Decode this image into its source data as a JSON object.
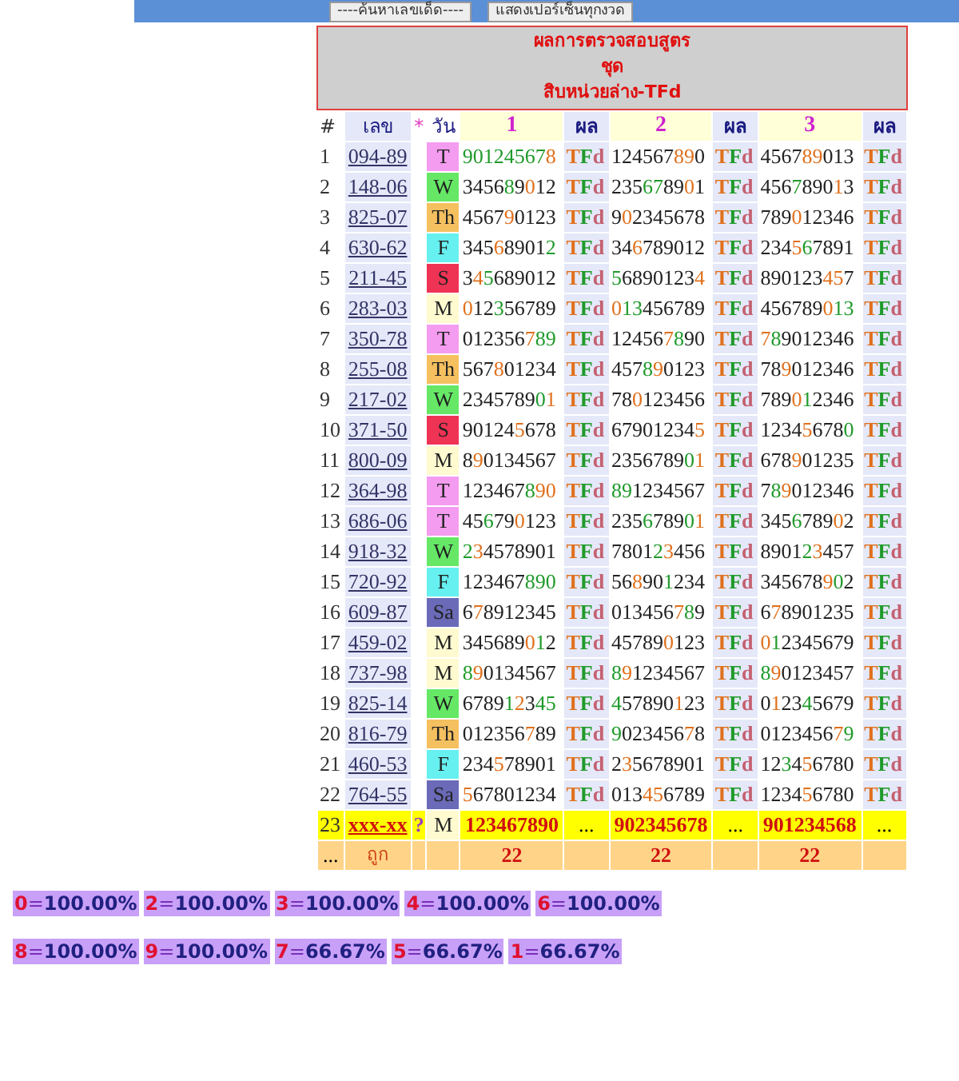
{
  "top_bar": {
    "buttons": [
      "----ค้นหาเลขเด็ด----",
      "แสดงเปอร์เซ็นทุกงวด"
    ]
  },
  "title": [
    "ผลการตรวจสอบสูตร",
    "ชุด",
    "สิบหน่วยล่าง-TFd"
  ],
  "columns": [
    "#",
    "เลข",
    "*",
    "วัน",
    "1",
    "ผล",
    "2",
    "ผล",
    "3",
    "ผล"
  ],
  "rows": [
    {
      "kind": "check",
      "no": "1",
      "number": "094-89",
      "day": "T",
      "color": "#f49cf0",
      "sets": [
        {
          "segments": [
            {
              "text": "90124567",
              "color": "#1f9a2a"
            },
            {
              "text": "8",
              "color": "#e0701c"
            }
          ],
          "result": "TFd"
        },
        {
          "segments": [
            {
              "text": "124567",
              "color": "#222222"
            },
            {
              "text": "89",
              "color": "#e0701c"
            },
            {
              "text": "0",
              "color": "#222222"
            }
          ],
          "result": "TFd"
        },
        {
          "segments": [
            {
              "text": "4567",
              "color": "#222222"
            },
            {
              "text": "89",
              "color": "#e0701c"
            },
            {
              "text": "013",
              "color": "#222222"
            }
          ],
          "result": "TFd"
        }
      ]
    },
    {
      "kind": "check",
      "no": "2",
      "number": "148-06",
      "day": "W",
      "color": "#66e866",
      "sets": [
        {
          "segments": [
            {
              "text": "3456",
              "color": "#222222"
            },
            {
              "text": "8",
              "color": "#1f9a2a"
            },
            {
              "text": "9",
              "color": "#222222"
            },
            {
              "text": "0",
              "color": "#e0701c"
            },
            {
              "text": "12",
              "color": "#222222"
            }
          ],
          "result": "TFd"
        },
        {
          "segments": [
            {
              "text": "235",
              "color": "#222222"
            },
            {
              "text": "67",
              "color": "#1f9a2a"
            },
            {
              "text": "89",
              "color": "#222222"
            },
            {
              "text": "0",
              "color": "#e0701c"
            },
            {
              "text": "1",
              "color": "#222222"
            }
          ],
          "result": "TFd"
        },
        {
          "segments": [
            {
              "text": "456",
              "color": "#222222"
            },
            {
              "text": "7",
              "color": "#1f9a2a"
            },
            {
              "text": "890",
              "color": "#222222"
            },
            {
              "text": "1",
              "color": "#e0701c"
            },
            {
              "text": "3",
              "color": "#222222"
            }
          ],
          "result": "TFd"
        }
      ]
    },
    {
      "kind": "check",
      "no": "3",
      "number": "825-07",
      "day": "Th",
      "color": "#f5c060",
      "sets": [
        {
          "segments": [
            {
              "text": "4567",
              "color": "#222222"
            },
            {
              "text": "9",
              "color": "#e0701c"
            },
            {
              "text": "0123",
              "color": "#222222"
            }
          ],
          "result": "TFd"
        },
        {
          "segments": [
            {
              "text": "9",
              "color": "#222222"
            },
            {
              "text": "0",
              "color": "#e0701c"
            },
            {
              "text": "2345678",
              "color": "#222222"
            }
          ],
          "result": "TFd"
        },
        {
          "segments": [
            {
              "text": "789",
              "color": "#222222"
            },
            {
              "text": "0",
              "color": "#e0701c"
            },
            {
              "text": "12346",
              "color": "#222222"
            }
          ],
          "result": "TFd"
        }
      ]
    },
    {
      "kind": "check",
      "no": "4",
      "number": "630-62",
      "day": "F",
      "color": "#66f0f0",
      "sets": [
        {
          "segments": [
            {
              "text": "345",
              "color": "#222222"
            },
            {
              "text": "6",
              "color": "#e0701c"
            },
            {
              "text": "8901",
              "color": "#222222"
            },
            {
              "text": "2",
              "color": "#1f9a2a"
            }
          ],
          "result": "TFd"
        },
        {
          "segments": [
            {
              "text": "34",
              "color": "#222222"
            },
            {
              "text": "6",
              "color": "#e0701c"
            },
            {
              "text": "789012",
              "color": "#222222"
            }
          ],
          "result": "TFd"
        },
        {
          "segments": [
            {
              "text": "234",
              "color": "#222222"
            },
            {
              "text": "5",
              "color": "#e0701c"
            },
            {
              "text": "6",
              "color": "#1f9a2a"
            },
            {
              "text": "7891",
              "color": "#222222"
            }
          ],
          "result": "TFd"
        }
      ]
    },
    {
      "kind": "check",
      "no": "5",
      "number": "211-45",
      "day": "S",
      "color": "#ee3355",
      "sets": [
        {
          "segments": [
            {
              "text": "3",
              "color": "#222222"
            },
            {
              "text": "4",
              "color": "#e0701c"
            },
            {
              "text": "5",
              "color": "#1f9a2a"
            },
            {
              "text": "689012",
              "color": "#222222"
            }
          ],
          "result": "TFd"
        },
        {
          "segments": [
            {
              "text": "5",
              "color": "#1f9a2a"
            },
            {
              "text": "6890123",
              "color": "#222222"
            },
            {
              "text": "4",
              "color": "#e0701c"
            }
          ],
          "result": "TFd"
        },
        {
          "segments": [
            {
              "text": "890123",
              "color": "#222222"
            },
            {
              "text": "45",
              "color": "#e0701c"
            },
            {
              "text": "7",
              "color": "#222222"
            }
          ],
          "result": "TFd"
        }
      ]
    },
    {
      "kind": "check",
      "no": "6",
      "number": "283-03",
      "day": "M",
      "color": "#fffad0",
      "sets": [
        {
          "segments": [
            {
              "text": "0",
              "color": "#e0701c"
            },
            {
              "text": "12",
              "color": "#222222"
            },
            {
              "text": "3",
              "color": "#1f9a2a"
            },
            {
              "text": "56789",
              "color": "#222222"
            }
          ],
          "result": "TFd"
        },
        {
          "segments": [
            {
              "text": "0",
              "color": "#e0701c"
            },
            {
              "text": "13",
              "color": "#1f9a2a"
            },
            {
              "text": "456789",
              "color": "#222222"
            }
          ],
          "result": "TFd"
        },
        {
          "segments": [
            {
              "text": "456789",
              "color": "#222222"
            },
            {
              "text": "0",
              "color": "#e0701c"
            },
            {
              "text": "13",
              "color": "#1f9a2a"
            }
          ],
          "result": "TFd"
        }
      ]
    },
    {
      "kind": "check",
      "no": "7",
      "number": "350-78",
      "day": "T",
      "color": "#f49cf0",
      "sets": [
        {
          "segments": [
            {
              "text": "012356",
              "color": "#222222"
            },
            {
              "text": "7",
              "color": "#e0701c"
            },
            {
              "text": "89",
              "color": "#1f9a2a"
            }
          ],
          "result": "TFd"
        },
        {
          "segments": [
            {
              "text": "12456",
              "color": "#222222"
            },
            {
              "text": "7",
              "color": "#e0701c"
            },
            {
              "text": "8",
              "color": "#1f9a2a"
            },
            {
              "text": "90",
              "color": "#222222"
            }
          ],
          "result": "TFd"
        },
        {
          "segments": [
            {
              "text": "7",
              "color": "#e0701c"
            },
            {
              "text": "8",
              "color": "#1f9a2a"
            },
            {
              "text": "9012346",
              "color": "#222222"
            }
          ],
          "result": "TFd"
        }
      ]
    },
    {
      "kind": "check",
      "no": "8",
      "number": "255-08",
      "day": "Th",
      "color": "#f5c060",
      "sets": [
        {
          "segments": [
            {
              "text": "567",
              "color": "#222222"
            },
            {
              "text": "8",
              "color": "#e0701c"
            },
            {
              "text": "01234",
              "color": "#222222"
            }
          ],
          "result": "TFd"
        },
        {
          "segments": [
            {
              "text": "457",
              "color": "#222222"
            },
            {
              "text": "8",
              "color": "#1f9a2a"
            },
            {
              "text": "9",
              "color": "#e0701c"
            },
            {
              "text": "0123",
              "color": "#222222"
            }
          ],
          "result": "TFd"
        },
        {
          "segments": [
            {
              "text": "78",
              "color": "#222222"
            },
            {
              "text": "9",
              "color": "#e0701c"
            },
            {
              "text": "012346",
              "color": "#222222"
            }
          ],
          "result": "TFd"
        }
      ]
    },
    {
      "kind": "check",
      "no": "9",
      "number": "217-02",
      "day": "W",
      "color": "#66e866",
      "sets": [
        {
          "segments": [
            {
              "text": "2345789",
              "color": "#222222"
            },
            {
              "text": "0",
              "color": "#1f9a2a"
            },
            {
              "text": "1",
              "color": "#e0701c"
            }
          ],
          "result": "TFd"
        },
        {
          "segments": [
            {
              "text": "78",
              "color": "#222222"
            },
            {
              "text": "0",
              "color": "#e0701c"
            },
            {
              "text": "123456",
              "color": "#222222"
            }
          ],
          "result": "TFd"
        },
        {
          "segments": [
            {
              "text": "789",
              "color": "#222222"
            },
            {
              "text": "0",
              "color": "#e0701c"
            },
            {
              "text": "1",
              "color": "#1f9a2a"
            },
            {
              "text": "2346",
              "color": "#222222"
            }
          ],
          "result": "TFd"
        }
      ]
    },
    {
      "kind": "check",
      "no": "10",
      "number": "371-50",
      "day": "S",
      "color": "#ee3355",
      "sets": [
        {
          "segments": [
            {
              "text": "90124",
              "color": "#222222"
            },
            {
              "text": "5",
              "color": "#e0701c"
            },
            {
              "text": "678",
              "color": "#222222"
            }
          ],
          "result": "TFd"
        },
        {
          "segments": [
            {
              "text": "67901234",
              "color": "#222222"
            },
            {
              "text": "5",
              "color": "#e0701c"
            }
          ],
          "result": "TFd"
        },
        {
          "segments": [
            {
              "text": "1234",
              "color": "#222222"
            },
            {
              "text": "5",
              "color": "#e0701c"
            },
            {
              "text": "678",
              "color": "#222222"
            },
            {
              "text": "0",
              "color": "#1f9a2a"
            }
          ],
          "result": "TFd"
        }
      ]
    },
    {
      "kind": "check",
      "no": "11",
      "number": "800-09",
      "day": "M",
      "color": "#fffad0",
      "sets": [
        {
          "segments": [
            {
              "text": "8",
              "color": "#222222"
            },
            {
              "text": "9",
              "color": "#e0701c"
            },
            {
              "text": "0134567",
              "color": "#222222"
            }
          ],
          "result": "TFd"
        },
        {
          "segments": [
            {
              "text": "2356789",
              "color": "#222222"
            },
            {
              "text": "0",
              "color": "#1f9a2a"
            },
            {
              "text": "1",
              "color": "#e0701c"
            }
          ],
          "result": "TFd"
        },
        {
          "segments": [
            {
              "text": "678",
              "color": "#222222"
            },
            {
              "text": "9",
              "color": "#e0701c"
            },
            {
              "text": "01235",
              "color": "#222222"
            }
          ],
          "result": "TFd"
        }
      ]
    },
    {
      "kind": "check",
      "no": "12",
      "number": "364-98",
      "day": "T",
      "color": "#f49cf0",
      "sets": [
        {
          "segments": [
            {
              "text": "123467",
              "color": "#222222"
            },
            {
              "text": "8",
              "color": "#1f9a2a"
            },
            {
              "text": "90",
              "color": "#e0701c"
            }
          ],
          "result": "TFd"
        },
        {
          "segments": [
            {
              "text": "89",
              "color": "#1f9a2a"
            },
            {
              "text": "1234567",
              "color": "#222222"
            }
          ],
          "result": "TFd"
        },
        {
          "segments": [
            {
              "text": "7",
              "color": "#222222"
            },
            {
              "text": "8",
              "color": "#1f9a2a"
            },
            {
              "text": "9",
              "color": "#e0701c"
            },
            {
              "text": "012346",
              "color": "#222222"
            }
          ],
          "result": "TFd"
        }
      ]
    },
    {
      "kind": "check",
      "no": "13",
      "number": "686-06",
      "day": "T",
      "color": "#f49cf0",
      "sets": [
        {
          "segments": [
            {
              "text": "45",
              "color": "#222222"
            },
            {
              "text": "6",
              "color": "#1f9a2a"
            },
            {
              "text": "79",
              "color": "#222222"
            },
            {
              "text": "0",
              "color": "#e0701c"
            },
            {
              "text": "123",
              "color": "#222222"
            }
          ],
          "result": "TFd"
        },
        {
          "segments": [
            {
              "text": "235",
              "color": "#222222"
            },
            {
              "text": "6",
              "color": "#1f9a2a"
            },
            {
              "text": "789",
              "color": "#222222"
            },
            {
              "text": "0",
              "color": "#1f9a2a"
            },
            {
              "text": "1",
              "color": "#e0701c"
            }
          ],
          "result": "TFd"
        },
        {
          "segments": [
            {
              "text": "345",
              "color": "#222222"
            },
            {
              "text": "6",
              "color": "#1f9a2a"
            },
            {
              "text": "789",
              "color": "#222222"
            },
            {
              "text": "0",
              "color": "#e0701c"
            },
            {
              "text": "2",
              "color": "#222222"
            }
          ],
          "result": "TFd"
        }
      ]
    },
    {
      "kind": "check",
      "no": "14",
      "number": "918-32",
      "day": "W",
      "color": "#66e866",
      "sets": [
        {
          "segments": [
            {
              "text": "2",
              "color": "#1f9a2a"
            },
            {
              "text": "3",
              "color": "#e0701c"
            },
            {
              "text": "4578901",
              "color": "#222222"
            }
          ],
          "result": "TFd"
        },
        {
          "segments": [
            {
              "text": "7801",
              "color": "#222222"
            },
            {
              "text": "2",
              "color": "#1f9a2a"
            },
            {
              "text": "3",
              "color": "#e0701c"
            },
            {
              "text": "456",
              "color": "#222222"
            }
          ],
          "result": "TFd"
        },
        {
          "segments": [
            {
              "text": "8901",
              "color": "#222222"
            },
            {
              "text": "2",
              "color": "#1f9a2a"
            },
            {
              "text": "3",
              "color": "#e0701c"
            },
            {
              "text": "457",
              "color": "#222222"
            }
          ],
          "result": "TFd"
        }
      ]
    },
    {
      "kind": "check",
      "no": "15",
      "number": "720-92",
      "day": "F",
      "color": "#66f0f0",
      "sets": [
        {
          "segments": [
            {
              "text": "123467",
              "color": "#222222"
            },
            {
              "text": "890",
              "color": "#1f9a2a"
            }
          ],
          "result": "TFd"
        },
        {
          "segments": [
            {
              "text": "56",
              "color": "#222222"
            },
            {
              "text": "8",
              "color": "#e0701c"
            },
            {
              "text": "90",
              "color": "#222222"
            },
            {
              "text": "1",
              "color": "#1f9a2a"
            },
            {
              "text": "234",
              "color": "#222222"
            }
          ],
          "result": "TFd"
        },
        {
          "segments": [
            {
              "text": "345678",
              "color": "#222222"
            },
            {
              "text": "9",
              "color": "#e0701c"
            },
            {
              "text": "0",
              "color": "#1f9a2a"
            },
            {
              "text": "2",
              "color": "#222222"
            }
          ],
          "result": "TFd"
        }
      ]
    },
    {
      "kind": "check",
      "no": "16",
      "number": "609-87",
      "day": "Sa",
      "color": "#6a6ab8",
      "sets": [
        {
          "segments": [
            {
              "text": "6",
              "color": "#222222"
            },
            {
              "text": "7",
              "color": "#e0701c"
            },
            {
              "text": "8912345",
              "color": "#222222"
            }
          ],
          "result": "TFd"
        },
        {
          "segments": [
            {
              "text": "013456",
              "color": "#222222"
            },
            {
              "text": "7",
              "color": "#e0701c"
            },
            {
              "text": "8",
              "color": "#1f9a2a"
            },
            {
              "text": "9",
              "color": "#222222"
            }
          ],
          "result": "TFd"
        },
        {
          "segments": [
            {
              "text": "6",
              "color": "#222222"
            },
            {
              "text": "7",
              "color": "#e0701c"
            },
            {
              "text": "8901235",
              "color": "#222222"
            }
          ],
          "result": "TFd"
        }
      ]
    },
    {
      "kind": "check",
      "no": "17",
      "number": "459-02",
      "day": "M",
      "color": "#fffad0",
      "sets": [
        {
          "segments": [
            {
              "text": "345689",
              "color": "#222222"
            },
            {
              "text": "0",
              "color": "#e0701c"
            },
            {
              "text": "1",
              "color": "#1f9a2a"
            },
            {
              "text": "2",
              "color": "#222222"
            }
          ],
          "result": "TFd"
        },
        {
          "segments": [
            {
              "text": "45789",
              "color": "#222222"
            },
            {
              "text": "0",
              "color": "#e0701c"
            },
            {
              "text": "123",
              "color": "#222222"
            }
          ],
          "result": "TFd"
        },
        {
          "segments": [
            {
              "text": "0",
              "color": "#e0701c"
            },
            {
              "text": "1",
              "color": "#1f9a2a"
            },
            {
              "text": "2345679",
              "color": "#222222"
            }
          ],
          "result": "TFd"
        }
      ]
    },
    {
      "kind": "check",
      "no": "18",
      "number": "737-98",
      "day": "M",
      "color": "#fffad0",
      "sets": [
        {
          "segments": [
            {
              "text": "8",
              "color": "#1f9a2a"
            },
            {
              "text": "9",
              "color": "#e0701c"
            },
            {
              "text": "0134567",
              "color": "#222222"
            }
          ],
          "result": "TFd"
        },
        {
          "segments": [
            {
              "text": "8",
              "color": "#1f9a2a"
            },
            {
              "text": "9",
              "color": "#e0701c"
            },
            {
              "text": "1234567",
              "color": "#222222"
            }
          ],
          "result": "TFd"
        },
        {
          "segments": [
            {
              "text": "8",
              "color": "#1f9a2a"
            },
            {
              "text": "9",
              "color": "#e0701c"
            },
            {
              "text": "0123457",
              "color": "#222222"
            }
          ],
          "result": "TFd"
        }
      ]
    },
    {
      "kind": "check",
      "no": "19",
      "number": "825-14",
      "day": "W",
      "color": "#66e866",
      "sets": [
        {
          "segments": [
            {
              "text": "6789",
              "color": "#222222"
            },
            {
              "text": "1",
              "color": "#1f9a2a"
            },
            {
              "text": "2",
              "color": "#e0701c"
            },
            {
              "text": "3",
              "color": "#222222"
            },
            {
              "text": "45",
              "color": "#1f9a2a"
            }
          ],
          "result": "TFd"
        },
        {
          "segments": [
            {
              "text": "4",
              "color": "#1f9a2a"
            },
            {
              "text": "57890",
              "color": "#222222"
            },
            {
              "text": "1",
              "color": "#e0701c"
            },
            {
              "text": "23",
              "color": "#222222"
            }
          ],
          "result": "TFd"
        },
        {
          "segments": [
            {
              "text": "0",
              "color": "#222222"
            },
            {
              "text": "1",
              "color": "#e0701c"
            },
            {
              "text": "23",
              "color": "#222222"
            },
            {
              "text": "4",
              "color": "#1f9a2a"
            },
            {
              "text": "5679",
              "color": "#222222"
            }
          ],
          "result": "TFd"
        }
      ]
    },
    {
      "kind": "check",
      "no": "20",
      "number": "816-79",
      "day": "Th",
      "color": "#f5c060",
      "sets": [
        {
          "segments": [
            {
              "text": "012356",
              "color": "#222222"
            },
            {
              "text": "7",
              "color": "#e0701c"
            },
            {
              "text": "89",
              "color": "#222222"
            }
          ],
          "result": "TFd"
        },
        {
          "segments": [
            {
              "text": "9",
              "color": "#1f9a2a"
            },
            {
              "text": "023456",
              "color": "#222222"
            },
            {
              "text": "7",
              "color": "#e0701c"
            },
            {
              "text": "8",
              "color": "#222222"
            }
          ],
          "result": "TFd"
        },
        {
          "segments": [
            {
              "text": "0123456",
              "color": "#222222"
            },
            {
              "text": "7",
              "color": "#e0701c"
            },
            {
              "text": "9",
              "color": "#1f9a2a"
            }
          ],
          "result": "TFd"
        }
      ]
    },
    {
      "kind": "check",
      "no": "21",
      "number": "460-53",
      "day": "F",
      "color": "#66f0f0",
      "sets": [
        {
          "segments": [
            {
              "text": "234",
              "color": "#222222"
            },
            {
              "text": "5",
              "color": "#e0701c"
            },
            {
              "text": "78901",
              "color": "#222222"
            }
          ],
          "result": "TFd"
        },
        {
          "segments": [
            {
              "text": "2",
              "color": "#222222"
            },
            {
              "text": "3",
              "color": "#e0701c"
            },
            {
              "text": "5678901",
              "color": "#222222"
            }
          ],
          "result": "TFd"
        },
        {
          "segments": [
            {
              "text": "12",
              "color": "#222222"
            },
            {
              "text": "3",
              "color": "#1f9a2a"
            },
            {
              "text": "4",
              "color": "#222222"
            },
            {
              "text": "5",
              "color": "#e0701c"
            },
            {
              "text": "6780",
              "color": "#222222"
            }
          ],
          "result": "TFd"
        }
      ]
    },
    {
      "kind": "check",
      "no": "22",
      "number": "764-55",
      "day": "Sa",
      "color": "#6a6ab8",
      "sets": [
        {
          "segments": [
            {
              "text": "5",
              "color": "#e0701c"
            },
            {
              "text": "67801234",
              "color": "#222222"
            }
          ],
          "result": "TFd"
        },
        {
          "segments": [
            {
              "text": "013",
              "color": "#222222"
            },
            {
              "text": "45",
              "color": "#e0701c"
            },
            {
              "text": "6789",
              "color": "#222222"
            }
          ],
          "result": "TFd"
        },
        {
          "segments": [
            {
              "text": "1234",
              "color": "#222222"
            },
            {
              "text": "5",
              "color": "#e0701c"
            },
            {
              "text": "6780",
              "color": "#222222"
            }
          ],
          "result": "TFd"
        }
      ]
    },
    {
      "kind": "pending",
      "no": "23",
      "number": "xxx-xx",
      "flag": "?",
      "day": "M",
      "color": "#fffad0",
      "sets": [
        {
          "digits": "123467890",
          "result": "..."
        },
        {
          "digits": "902345678",
          "result": "..."
        },
        {
          "digits": "901234568",
          "result": "..."
        }
      ]
    }
  ],
  "summary": {
    "no": "...",
    "label": "ถูก",
    "counts": [
      "22",
      "22",
      "22"
    ]
  },
  "percentages": [
    [
      {
        "digit": "0",
        "sep": "=",
        "value": "100.00%"
      },
      {
        "digit": "2",
        "sep": "=",
        "value": "100.00%"
      },
      {
        "digit": "3",
        "sep": "=",
        "value": "100.00%"
      },
      {
        "digit": "4",
        "sep": "=",
        "value": "100.00%"
      },
      {
        "digit": "6",
        "sep": "=",
        "value": "100.00%"
      }
    ],
    [
      {
        "digit": "8",
        "sep": "=",
        "value": "100.00%"
      },
      {
        "digit": "9",
        "sep": "=",
        "value": "100.00%"
      },
      {
        "digit": "7",
        "sep": "=",
        "value": "66.67%"
      },
      {
        "digit": "5",
        "sep": "=",
        "value": "66.67%"
      },
      {
        "digit": "1",
        "sep": "=",
        "value": "66.67%"
      }
    ]
  ]
}
